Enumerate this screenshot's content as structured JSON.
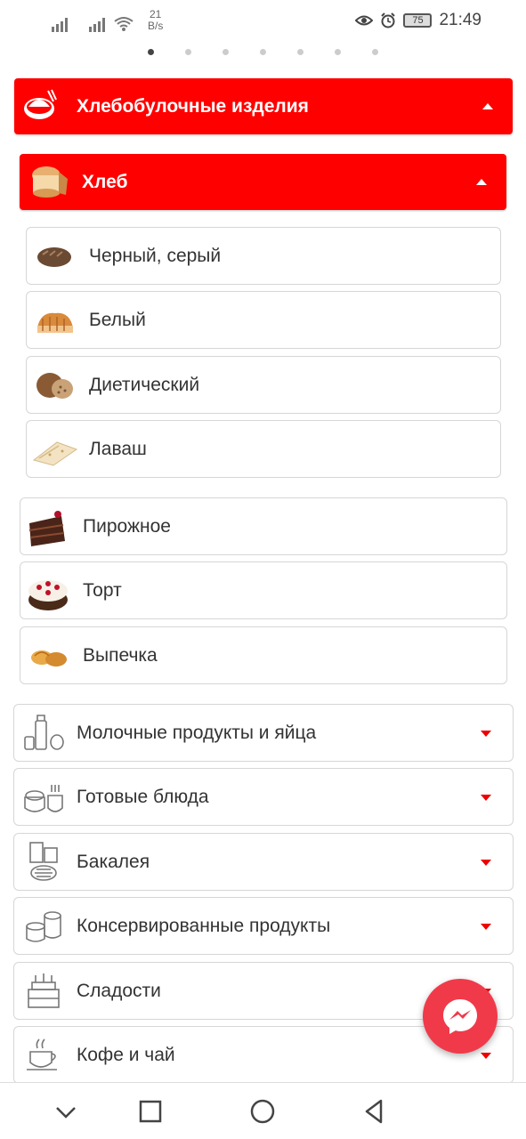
{
  "status_bar": {
    "speed_value": "21",
    "speed_unit": "B/s",
    "battery": "75",
    "time": "21:49",
    "icons": [
      "signal-icon",
      "signal-icon",
      "wifi-icon",
      "eye-icon",
      "alarm-icon",
      "battery-icon"
    ]
  },
  "pager": {
    "count": 7,
    "active": 0
  },
  "category_main": {
    "label": "Хлебобулочные изделия",
    "icon": "bread-basket-icon"
  },
  "subcategory": {
    "label": "Хлеб",
    "icon": "bread-loaf-icon"
  },
  "bread_items": [
    {
      "label": "Черный, серый",
      "icon": "dark-bread-icon"
    },
    {
      "label": "Белый",
      "icon": "white-bread-icon"
    },
    {
      "label": "Диетический",
      "icon": "diet-bread-icon"
    },
    {
      "label": "Лаваш",
      "icon": "lavash-icon"
    }
  ],
  "bakery_items": [
    {
      "label": "Пирожное",
      "icon": "pastry-icon"
    },
    {
      "label": "Торт",
      "icon": "cake-icon"
    },
    {
      "label": "Выпечка",
      "icon": "baked-goods-icon"
    }
  ],
  "categories": [
    {
      "label": "Молочные продукты и яйца",
      "icon": "dairy-icon"
    },
    {
      "label": "Готовые блюда",
      "icon": "ready-meals-icon"
    },
    {
      "label": "Бакалея",
      "icon": "grocery-icon"
    },
    {
      "label": "Консервированные продукты",
      "icon": "canned-icon"
    },
    {
      "label": "Сладости",
      "icon": "sweets-icon"
    },
    {
      "label": "Кофе и чай",
      "icon": "coffee-icon"
    }
  ],
  "colors": {
    "accent": "#ff0000",
    "fab": "#f03a4a",
    "caret": "#e00000"
  },
  "fab": {
    "icon": "messenger-icon"
  }
}
